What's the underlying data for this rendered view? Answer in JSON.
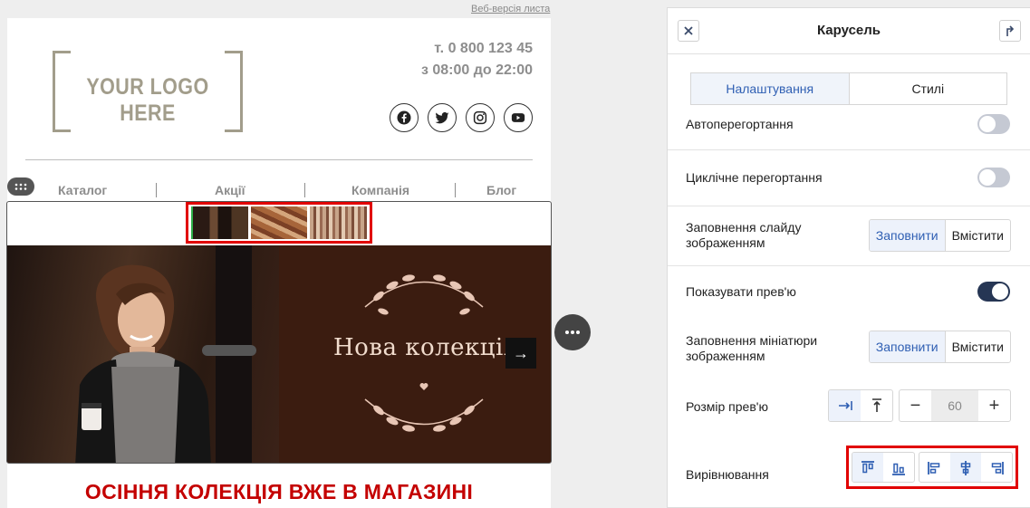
{
  "email": {
    "web_version": "Веб-версія листа",
    "logo_text": "YOUR LOGO HERE",
    "phone": "т. 0 800 123 45",
    "hours": "з 08:00 до 22:00",
    "socials": [
      "facebook-icon",
      "twitter-icon",
      "instagram-icon",
      "youtube-icon"
    ],
    "nav": [
      "Каталог",
      "Акції",
      "Компанія",
      "Блог"
    ],
    "slide_title": "Нова колекція",
    "next_arrow": "→",
    "headline": "ОСІННЯ КОЛЕКЦІЯ ВЖЕ В МАГАЗИНІ"
  },
  "panel": {
    "title": "Карусель",
    "tabs": [
      "Налаштування",
      "Стилі"
    ],
    "active_tab": "Налаштування",
    "autoscroll_label": "Автоперегортання",
    "autoscroll_on": false,
    "loop_label": "Циклічне перегортання",
    "loop_on": false,
    "slide_fill_label": "Заповнення слайду зображенням",
    "slide_fill_options": [
      "Заповнити",
      "Вмістити"
    ],
    "slide_fill_selected": "Заповнити",
    "show_preview_label": "Показувати прев'ю",
    "show_preview_on": true,
    "thumb_fill_label": "Заповнення мініатюри зображенням",
    "thumb_fill_options": [
      "Заповнити",
      "Вмістити"
    ],
    "thumb_fill_selected": "Заповнити",
    "preview_size_label": "Розмір прев'ю",
    "preview_size_value": "60",
    "minus": "−",
    "plus": "+",
    "alignment_label": "Вирівнювання"
  },
  "colors": {
    "accent": "#2f5fb3",
    "highlight": "#e10000",
    "headline": "#c40000",
    "toggle_on": "#263654"
  }
}
